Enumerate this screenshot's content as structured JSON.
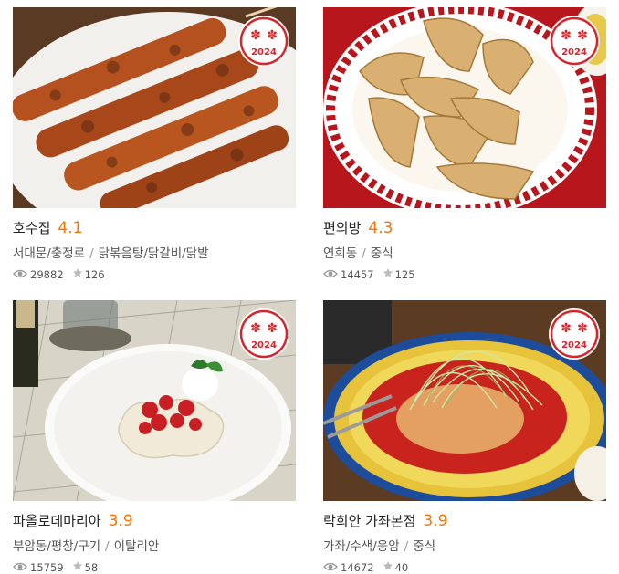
{
  "theme": {
    "accent": "#ff7100",
    "badge_red": "#d7252b"
  },
  "badge": {
    "year": "2024"
  },
  "restaurants": [
    {
      "name": "호수집",
      "score": "4.1",
      "area": "서대문/충정로",
      "category": "닭볶음탕/닭갈비/닭발",
      "views": "29882",
      "reviews": "126",
      "image": "chicken-skewers"
    },
    {
      "name": "편의방",
      "score": "4.3",
      "area": "연희동",
      "category": "중식",
      "views": "14457",
      "reviews": "125",
      "image": "fried-dumplings"
    },
    {
      "name": "파올로데마리아",
      "score": "3.9",
      "area": "부암동/평창/구기",
      "category": "이탈리안",
      "views": "15759",
      "reviews": "58",
      "image": "tomato-pasta"
    },
    {
      "name": "락희안 가좌본점",
      "score": "3.9",
      "area": "가좌/수색/응암",
      "category": "중식",
      "views": "14672",
      "reviews": "40",
      "image": "shrimp-scallion-dish"
    }
  ]
}
